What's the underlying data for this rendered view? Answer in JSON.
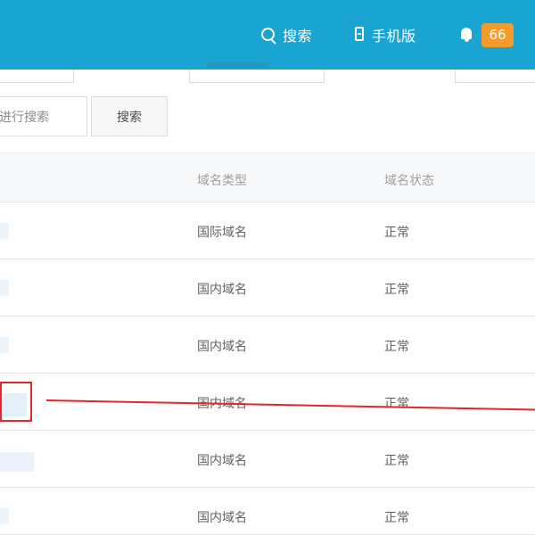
{
  "header": {
    "search_label": "搜索",
    "mobile_label": "手机版",
    "notification_count": "66",
    "background_color": "#19a4d2",
    "badge_color": "#f49b2e",
    "search_icon": "search-icon",
    "mobile_icon": "mobile-icon",
    "bell_icon": "bell-icon"
  },
  "search_bar": {
    "input_text": "进行搜索",
    "button_label": "搜索"
  },
  "domain_table": {
    "columns": {
      "type": "域名类型",
      "status": "域名状态"
    },
    "rows": [
      {
        "type": "国际域名",
        "status": "正常"
      },
      {
        "type": "国内域名",
        "status": "正常"
      },
      {
        "type": "国内域名",
        "status": "正常"
      },
      {
        "type": "国内域名",
        "status": "正常"
      },
      {
        "type": "国内域名",
        "status": "正常"
      },
      {
        "type": "国内域名",
        "status": "正常"
      }
    ]
  },
  "annotation": {
    "color": "#e0282f"
  }
}
